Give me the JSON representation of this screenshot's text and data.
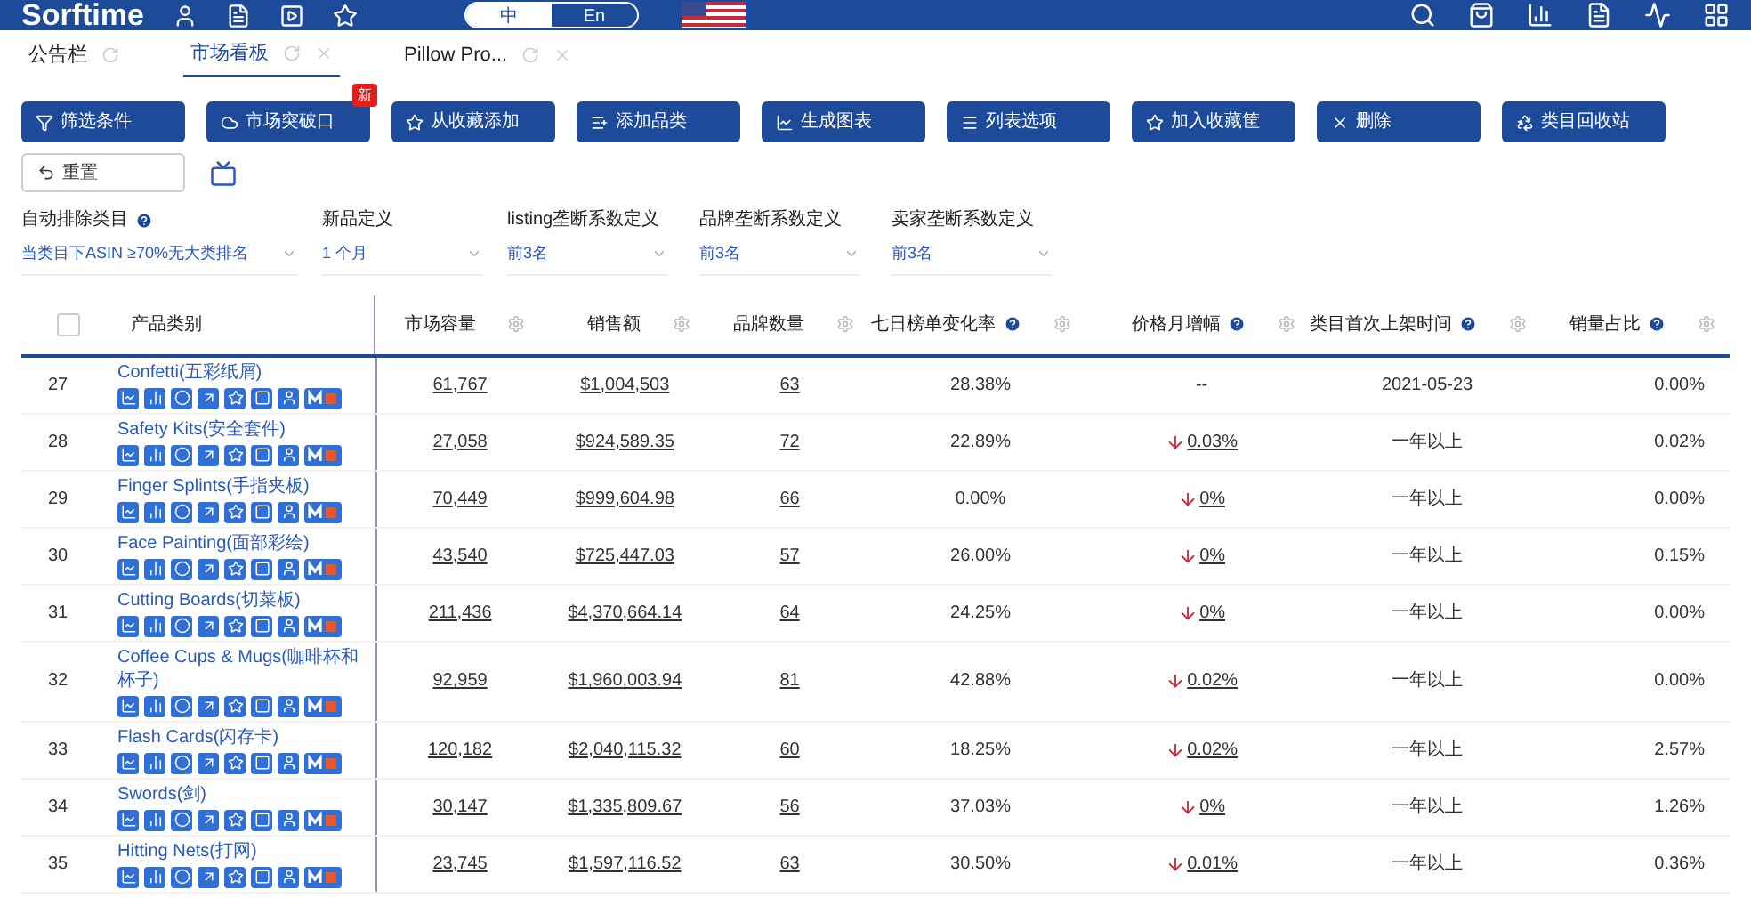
{
  "topbar": {
    "logo": "Sorftime",
    "languages": [
      {
        "label": "中",
        "selected": true
      },
      {
        "label": "En",
        "selected": false
      }
    ]
  },
  "tabs": [
    {
      "label": "公告栏",
      "selected": false,
      "closable": false
    },
    {
      "label": "市场看板",
      "selected": true,
      "closable": true
    },
    {
      "label": "Pillow Pro...",
      "selected": false,
      "closable": true
    }
  ],
  "toolbar": [
    {
      "label": "筛选条件"
    },
    {
      "label": "市场突破口",
      "badge": "新"
    },
    {
      "label": "从收藏添加"
    },
    {
      "label": "添加品类"
    },
    {
      "label": "生成图表"
    },
    {
      "label": "列表选项"
    },
    {
      "label": "加入收藏筐"
    },
    {
      "label": "删除"
    },
    {
      "label": "类目回收站"
    }
  ],
  "reset_button": "重置",
  "filters": [
    {
      "label": "自动排除类目",
      "help": true,
      "value": "当类目下ASIN ≥70%无大类排名"
    },
    {
      "label": "新品定义",
      "help": false,
      "value": "1 个月"
    },
    {
      "label": "listing垄断系数定义",
      "help": false,
      "value": "前3名"
    },
    {
      "label": "品牌垄断系数定义",
      "help": false,
      "value": "前3名"
    },
    {
      "label": "卖家垄断系数定义",
      "help": false,
      "value": "前3名"
    }
  ],
  "table": {
    "select_all": {
      "checked": false
    },
    "columns": [
      {
        "label": "产品类别",
        "help": false,
        "settings": false
      },
      {
        "label": "市场容量",
        "help": false,
        "settings": true
      },
      {
        "label": "销售额",
        "help": false,
        "settings": true
      },
      {
        "label": "品牌数量",
        "help": false,
        "settings": true
      },
      {
        "label": "七日榜单变化率",
        "help": true,
        "settings": true
      },
      {
        "label": "价格月增幅",
        "help": true,
        "settings": true
      },
      {
        "label": "类目首次上架时间",
        "help": true,
        "settings": true
      },
      {
        "label": "销量占比",
        "help": true,
        "settings": true
      }
    ],
    "rows": [
      {
        "index": "27",
        "category": "Confetti(五彩纸屑)",
        "capacity": "61,767",
        "sales": "$1,004,503",
        "brands": "63",
        "rank_change": "28.38%",
        "price_change": {
          "kind": "none",
          "text": "--"
        },
        "first_listed": "2021-05-23",
        "share": "0.00%"
      },
      {
        "index": "28",
        "category": "Safety Kits(安全套件)",
        "capacity": "27,058",
        "sales": "$924,589.35",
        "brands": "72",
        "rank_change": "22.89%",
        "price_change": {
          "kind": "down",
          "text": "0.03%"
        },
        "first_listed": "一年以上",
        "share": "0.02%"
      },
      {
        "index": "29",
        "category": "Finger Splints(手指夹板)",
        "capacity": "70,449",
        "sales": "$999,604.98",
        "brands": "66",
        "rank_change": "0.00%",
        "price_change": {
          "kind": "down",
          "text": "0%"
        },
        "first_listed": "一年以上",
        "share": "0.00%"
      },
      {
        "index": "30",
        "category": "Face Painting(面部彩绘)",
        "capacity": "43,540",
        "sales": "$725,447.03",
        "brands": "57",
        "rank_change": "26.00%",
        "price_change": {
          "kind": "down",
          "text": "0%"
        },
        "first_listed": "一年以上",
        "share": "0.15%"
      },
      {
        "index": "31",
        "category": "Cutting Boards(切菜板)",
        "capacity": "211,436",
        "sales": "$4,370,664.14",
        "brands": "64",
        "rank_change": "24.25%",
        "price_change": {
          "kind": "down",
          "text": "0%"
        },
        "first_listed": "一年以上",
        "share": "0.00%"
      },
      {
        "index": "32",
        "category": "Coffee Cups & Mugs(咖啡杯和杯子)",
        "capacity": "92,959",
        "sales": "$1,960,003.94",
        "brands": "81",
        "rank_change": "42.88%",
        "price_change": {
          "kind": "down",
          "text": "0.02%"
        },
        "first_listed": "一年以上",
        "share": "0.00%"
      },
      {
        "index": "33",
        "category": "Flash Cards(闪存卡)",
        "capacity": "120,182",
        "sales": "$2,040,115.32",
        "brands": "60",
        "rank_change": "18.25%",
        "price_change": {
          "kind": "down",
          "text": "0.02%"
        },
        "first_listed": "一年以上",
        "share": "2.57%"
      },
      {
        "index": "34",
        "category": "Swords(剑)",
        "capacity": "30,147",
        "sales": "$1,335,809.67",
        "brands": "56",
        "rank_change": "37.03%",
        "price_change": {
          "kind": "down",
          "text": "0%"
        },
        "first_listed": "一年以上",
        "share": "1.26%"
      },
      {
        "index": "35",
        "category": "Hitting Nets(打网)",
        "capacity": "23,745",
        "sales": "$1,597,116.52",
        "brands": "63",
        "rank_change": "30.50%",
        "price_change": {
          "kind": "down",
          "text": "0.01%"
        },
        "first_listed": "一年以上",
        "share": "0.36%"
      }
    ]
  }
}
